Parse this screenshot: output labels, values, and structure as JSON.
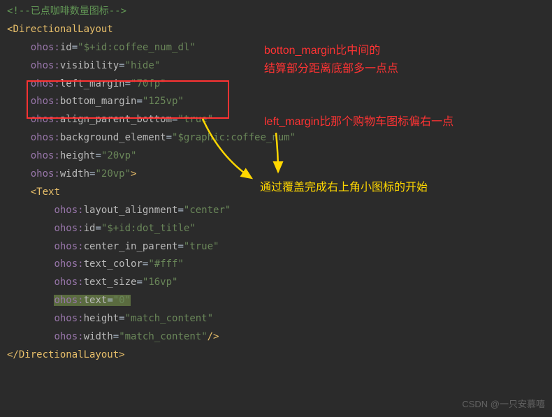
{
  "code": {
    "comment": "<!--已点咖啡数量图标-->",
    "open_tag": "DirectionalLayout",
    "close_tag": "DirectionalLayout",
    "attrs": {
      "l1_ns": "ohos:",
      "l1_name": "id",
      "l1_val": "\"$+id:coffee_num_dl\"",
      "l2_ns": "ohos:",
      "l2_name": "visibility",
      "l2_val": "\"hide\"",
      "l3_ns": "ohos:",
      "l3_name": "left_margin",
      "l3_val": "\"70fp\"",
      "l4_ns": "ohos:",
      "l4_name": "bottom_margin",
      "l4_val": "\"125vp\"",
      "l5_ns": "ohos:",
      "l5_name": "align_parent_bottom",
      "l5_val": "\"true\"",
      "l6_ns": "ohos:",
      "l6_name": "background_element",
      "l6_val": "\"$graphic:coffee_num\"",
      "l7_ns": "ohos:",
      "l7_name": "height",
      "l7_val": "\"20vp\"",
      "l8_ns": "ohos:",
      "l8_name": "width",
      "l8_val": "\"20vp\""
    },
    "inner_open": "Text",
    "inner": {
      "t1_ns": "ohos:",
      "t1_name": "layout_alignment",
      "t1_val": "\"center\"",
      "t2_ns": "ohos:",
      "t2_name": "id",
      "t2_val": "\"$+id:dot_title\"",
      "t3_ns": "ohos:",
      "t3_name": "center_in_parent",
      "t3_val": "\"true\"",
      "t4_ns": "ohos:",
      "t4_name": "text_color",
      "t4_val": "\"#fff\"",
      "t5_ns": "ohos:",
      "t5_name": "text_size",
      "t5_val": "\"16vp\"",
      "t6_ns": "ohos:",
      "t6_name": "text",
      "t6_val": "\"0\"",
      "t7_ns": "ohos:",
      "t7_name": "height",
      "t7_val": "\"match_content\"",
      "t8_ns": "ohos:",
      "t8_name": "width",
      "t8_val": "\"match_content\"",
      "self_close": "/>"
    },
    "gt": ">",
    "lt_open": "<",
    "lt_close": "</"
  },
  "annotations": {
    "red1a": "botton_margin比中间的",
    "red1b": "结算部分距离底部多一点点",
    "red2": "left_margin比那个购物车图标偏右一点",
    "yellow": "通过覆盖完成右上角小图标的开始"
  },
  "watermark": "CSDN @一只安慕嘻"
}
